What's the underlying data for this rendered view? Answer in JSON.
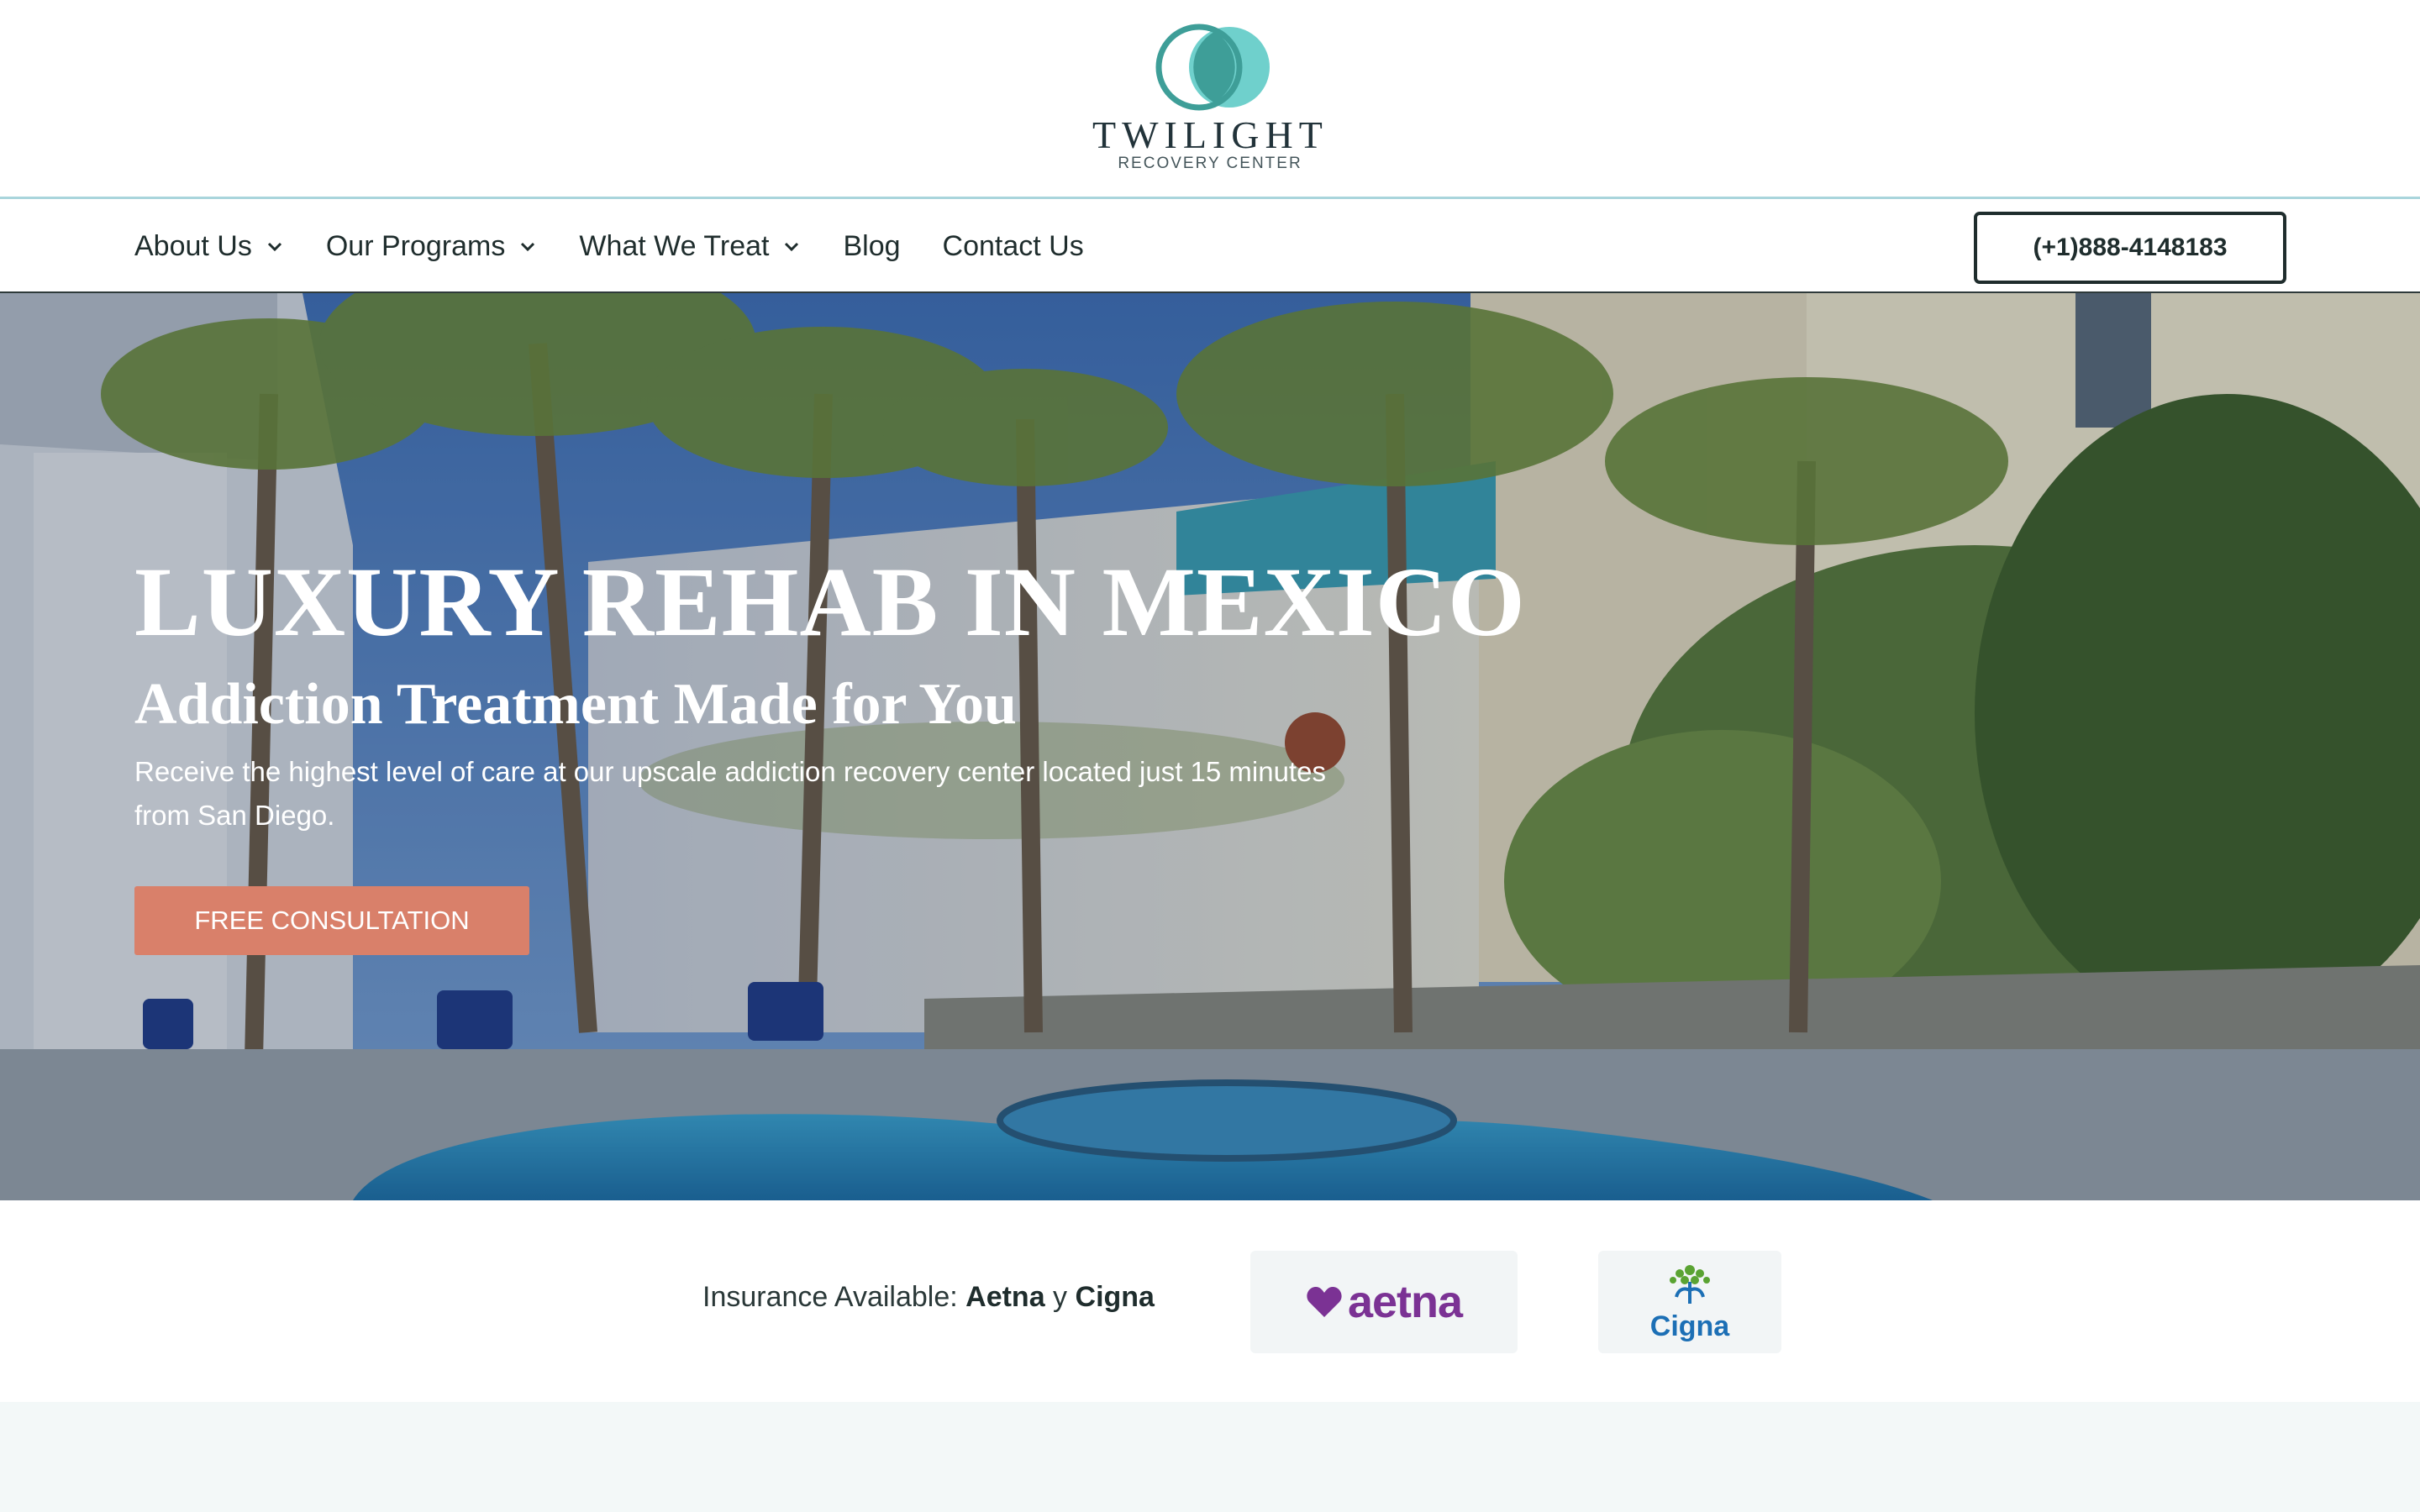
{
  "logo": {
    "name": "TWILIGHT",
    "tagline": "RECOVERY CENTER",
    "icon": "twin-circles-logo-icon",
    "colors": {
      "outer_ring": "#3e9e98",
      "inner_fill": "#6fd0cc"
    }
  },
  "nav": {
    "items": [
      {
        "label": "About Us",
        "has_dropdown": true
      },
      {
        "label": "Our Programs",
        "has_dropdown": true
      },
      {
        "label": "What We Treat",
        "has_dropdown": true
      },
      {
        "label": "Blog",
        "has_dropdown": false
      },
      {
        "label": "Contact Us",
        "has_dropdown": false
      }
    ],
    "phone": "(+1)888-4148183",
    "dropdown_icon": "chevron-down-icon"
  },
  "hero": {
    "title": "LUXURY REHAB IN MEXICO",
    "subtitle": "Addiction Treatment Made for You",
    "body": "Receive the highest level of care at our upscale addiction recovery center located just 15 minutes from San Diego.",
    "cta_label": "FREE CONSULTATION",
    "cta_color": "#d9806a"
  },
  "insurance": {
    "prefix": "Insurance Available: ",
    "provider_1": "Aetna",
    "joiner": " y ",
    "provider_2": "Cigna",
    "logos": [
      {
        "name": "aetna",
        "text": "aetna",
        "icon": "heart-icon",
        "color": "#7b3294"
      },
      {
        "name": "cigna",
        "text": "Cigna",
        "icon": "tree-of-life-icon",
        "color": "#1c6fb5"
      }
    ]
  }
}
